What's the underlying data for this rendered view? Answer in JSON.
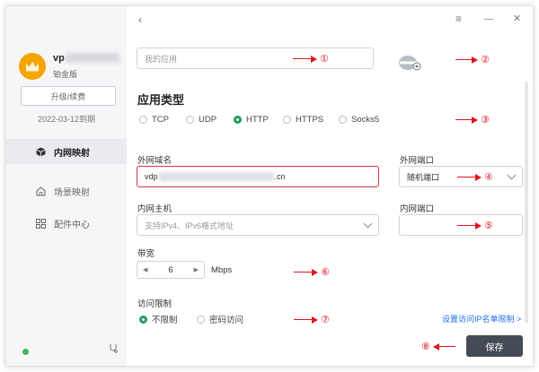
{
  "sidebar": {
    "username": "vp",
    "tier": "铂金版",
    "upgrade_label": "升级/续费",
    "expire_text": "2022-03-12到期",
    "nav": [
      {
        "label": "内网映射",
        "icon": "cube-icon",
        "active": true
      },
      {
        "label": "场景映射",
        "icon": "home-icon",
        "active": false
      },
      {
        "label": "配件中心",
        "icon": "grid-icon",
        "active": false
      }
    ]
  },
  "titlebar": {
    "back": "‹",
    "menu": "≡",
    "minimize": "—",
    "close": "✕"
  },
  "form": {
    "app_name_placeholder": "我的应用",
    "app_type_title": "应用类型",
    "protocols": [
      {
        "label": "TCP",
        "selected": false
      },
      {
        "label": "UDP",
        "selected": false
      },
      {
        "label": "HTTP",
        "selected": true
      },
      {
        "label": "HTTPS",
        "selected": false
      },
      {
        "label": "Socks5",
        "selected": false
      }
    ],
    "domain_label": "外网域名",
    "domain_prefix": "vdp",
    "domain_suffix": ".cn",
    "ext_port_label": "外网端口",
    "ext_port_value": "随机端口",
    "lan_host_label": "内网主机",
    "lan_host_placeholder": "支持IPv4、IPv6格式地址",
    "lan_port_label": "内网端口",
    "bandwidth_label": "带宽",
    "bandwidth_value": "6",
    "bandwidth_unit": "Mbps",
    "access_label": "访问限制",
    "access_options": [
      {
        "label": "不限制",
        "selected": true
      },
      {
        "label": "密码访问",
        "selected": false
      }
    ],
    "ip_link": "设置访问IP名单限制 >",
    "save_label": "保存"
  },
  "annotations": [
    "①",
    "②",
    "③",
    "④",
    "⑤",
    "⑥",
    "⑦",
    "⑧"
  ],
  "colors": {
    "accent": "#1f9d5b",
    "error": "#d83444",
    "annotation": "#e0141e",
    "save": "#454b55",
    "link": "#1c6ee8"
  }
}
